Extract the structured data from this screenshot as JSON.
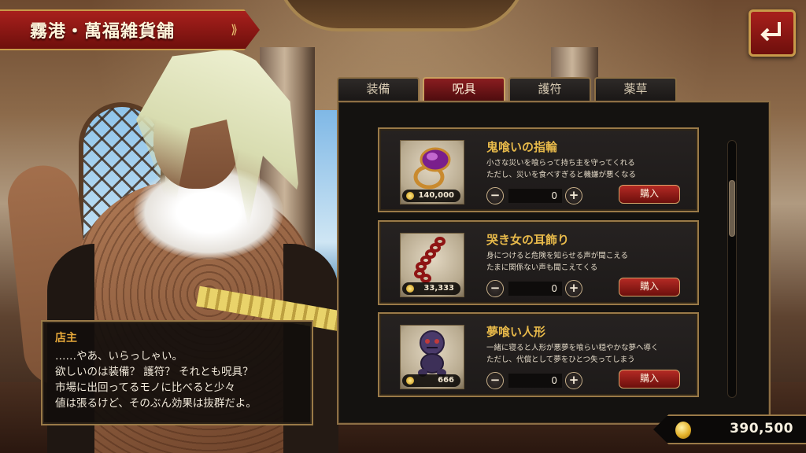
{
  "header": {
    "title": "霧港・萬福雑貨舗",
    "title_deco": "⟫"
  },
  "back_button": {
    "icon": "return-arrow-icon"
  },
  "tabs": [
    {
      "label": "装備",
      "active": false
    },
    {
      "label": "呪具",
      "active": true
    },
    {
      "label": "護符",
      "active": false
    },
    {
      "label": "薬草",
      "active": false
    }
  ],
  "items": [
    {
      "name": "鬼喰いの指輪",
      "desc_line1": "小さな災いを喰らって持ち主を守ってくれる",
      "desc_line2": "ただし、災いを食べすぎると機嫌が悪くなる",
      "price": "140,000",
      "quantity": "0",
      "minus": "−",
      "plus": "+",
      "buy_label": "購入",
      "icon": "ring-icon"
    },
    {
      "name": "哭き女の耳飾り",
      "desc_line1": "身につけると危険を知らせる声が聞こえる",
      "desc_line2": "たまに関係ない声も聞こえてくる",
      "price": "33,333",
      "quantity": "0",
      "minus": "−",
      "plus": "+",
      "buy_label": "購入",
      "icon": "earring-chain-icon"
    },
    {
      "name": "夢喰い人形",
      "desc_line1": "一緒に寝ると人形が悪夢を喰らい穏やかな夢へ導く",
      "desc_line2": "ただし、代償として夢をひとつ失ってしまう",
      "price": "666",
      "quantity": "0",
      "minus": "−",
      "plus": "+",
      "buy_label": "購入",
      "icon": "doll-icon"
    }
  ],
  "dialogue": {
    "speaker": "店主",
    "lines": [
      "……やあ、いらっしゃい。",
      "欲しいのは装備？ 護符？ それとも呪具？",
      "市場に出回ってるモノに比べると少々",
      "値は張るけど、そのぶん効果は抜群だよ。"
    ]
  },
  "currency": {
    "amount": "390,500",
    "icon": "gold-coin-icon"
  },
  "colors": {
    "accent_red": "#8a1d20",
    "gold_text": "#e7b94a",
    "border_gold": "#9a7a48"
  }
}
